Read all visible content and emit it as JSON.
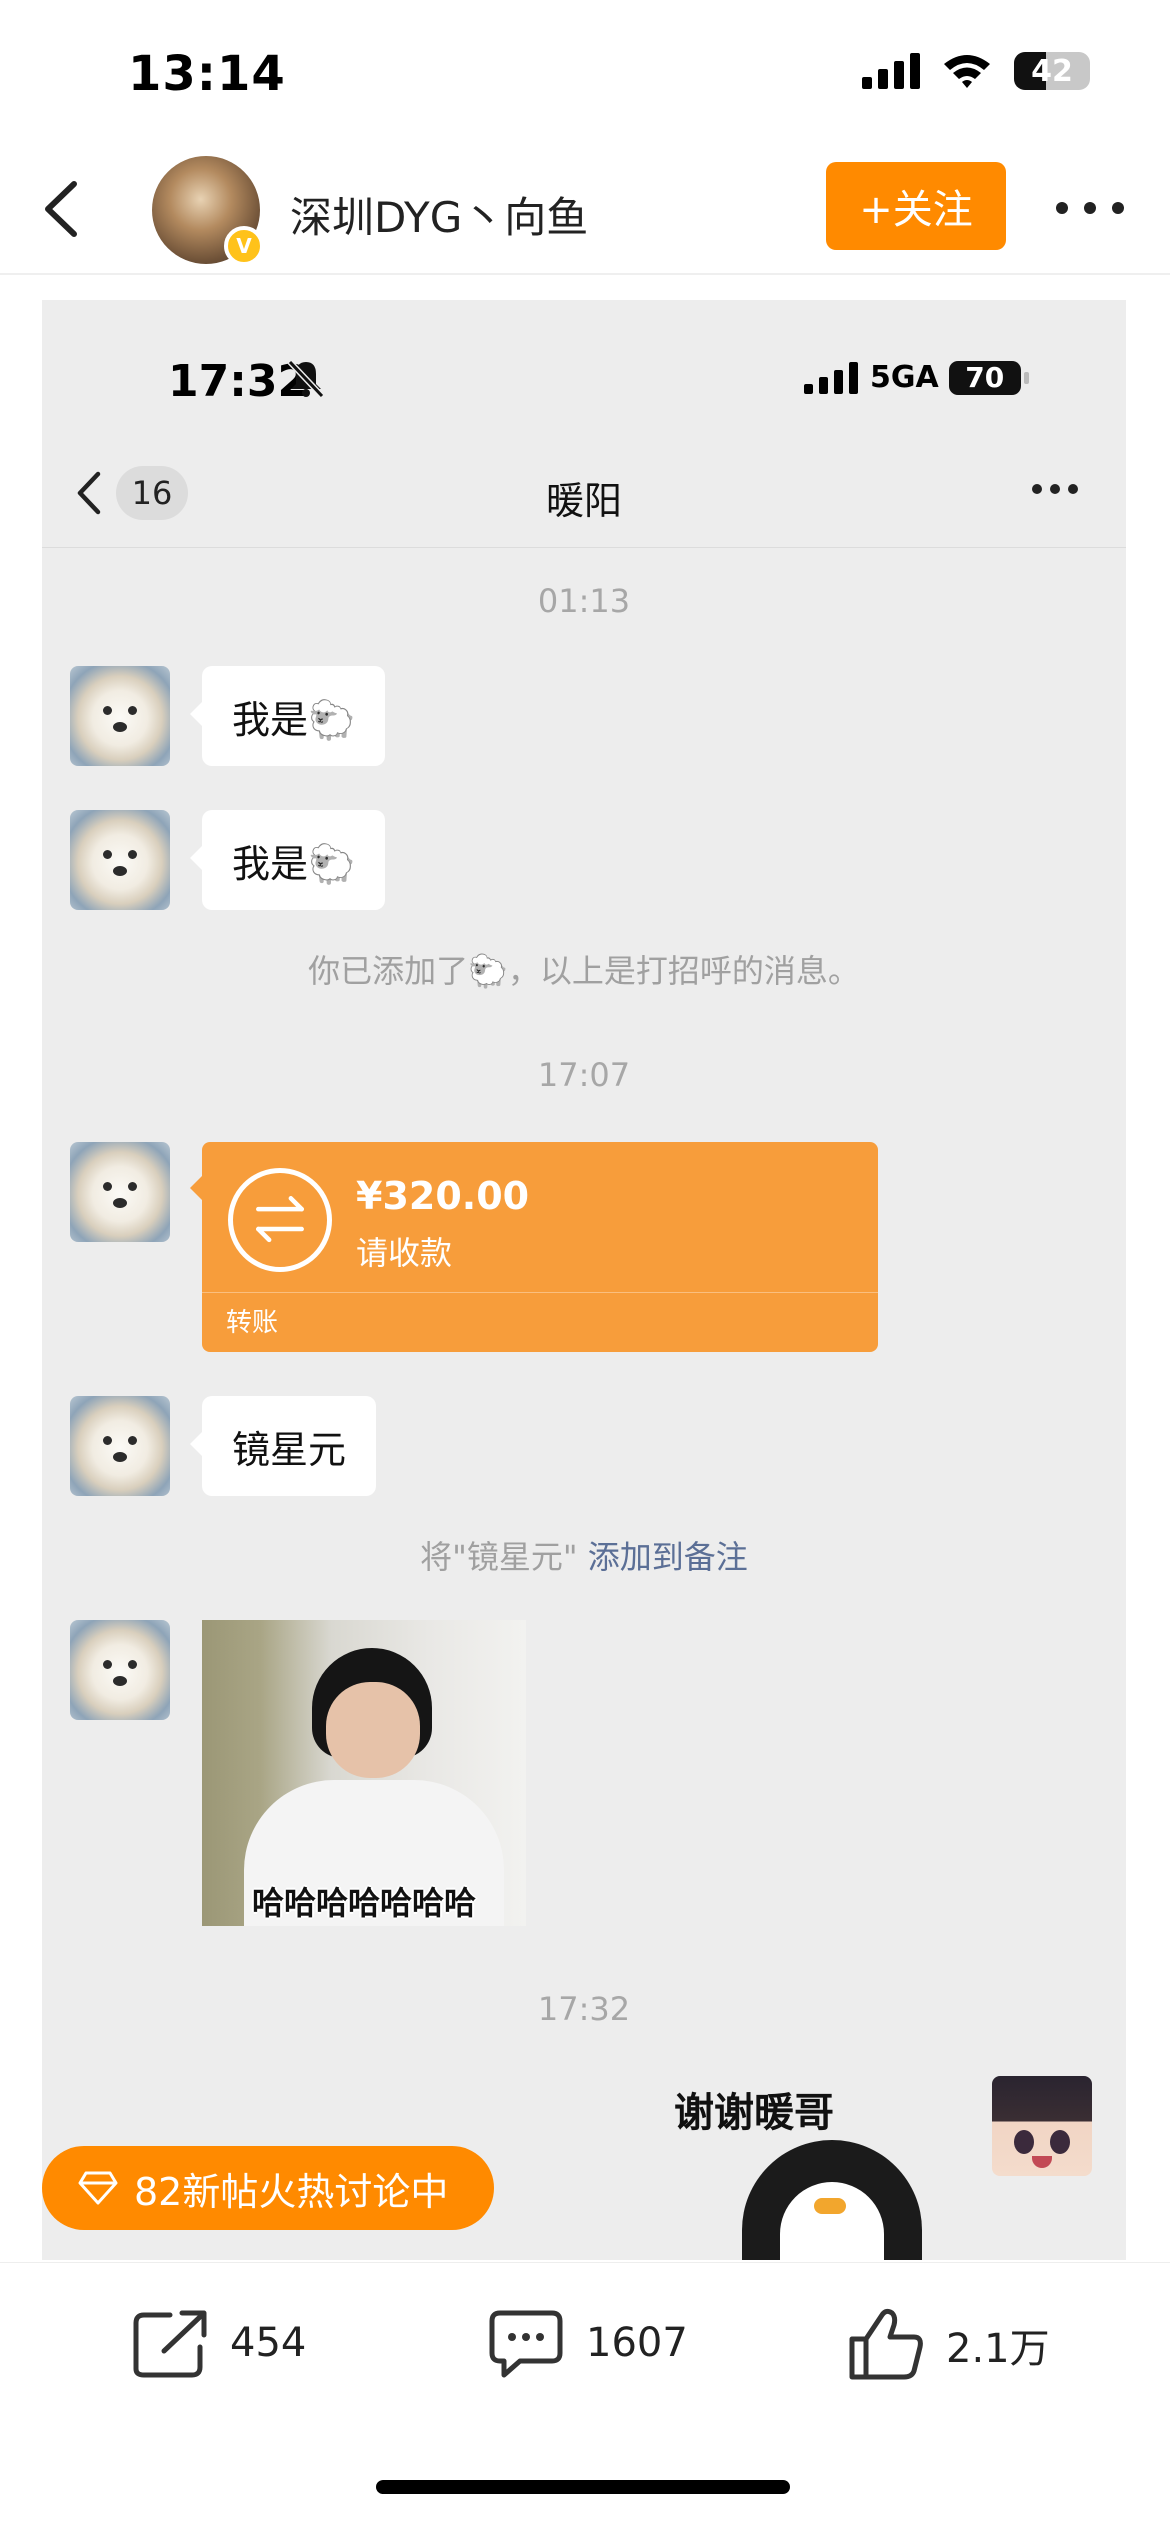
{
  "status_bar": {
    "time": "13:14",
    "battery": "42"
  },
  "header": {
    "username": "深圳DYG丶向鱼",
    "follow_label": "+关注",
    "verified_badge": "V"
  },
  "chat_screenshot": {
    "status_bar": {
      "time": "17:32",
      "network": "5GA",
      "battery": "70"
    },
    "nav": {
      "unread_count": "16",
      "title": "暖阳"
    },
    "timestamps": [
      "01:13",
      "17:07",
      "17:32"
    ],
    "messages": [
      {
        "text": "我是🐑"
      },
      {
        "text": "我是🐑"
      },
      {
        "text": "镜星元"
      }
    ],
    "system_messages": {
      "added_notice": "你已添加了🐑，以上是打招呼的消息。",
      "remark_prefix": "将\"镜星元\"",
      "remark_link": "添加到备注"
    },
    "transfer": {
      "amount": "¥320.00",
      "subtitle": "请收款",
      "label": "转账"
    },
    "photo_caption": "哈哈哈哈哈哈哈",
    "sticker_text": "谢谢暖哥"
  },
  "hot_badge": "82新帖火热讨论中",
  "actions": {
    "share": "454",
    "comments": "1607",
    "likes": "2.1万"
  },
  "colors": {
    "accent": "#ff8a00",
    "transfer": "#f79d3b",
    "chat_bg": "#ededed",
    "link": "#5b6f96"
  },
  "icons": [
    "cellular-signal-icon",
    "wifi-icon",
    "battery-icon",
    "back-chevron-icon",
    "more-dots-icon",
    "bell-muted-icon",
    "transfer-arrows-icon",
    "diamond-icon",
    "share-icon",
    "comment-icon",
    "like-icon"
  ]
}
